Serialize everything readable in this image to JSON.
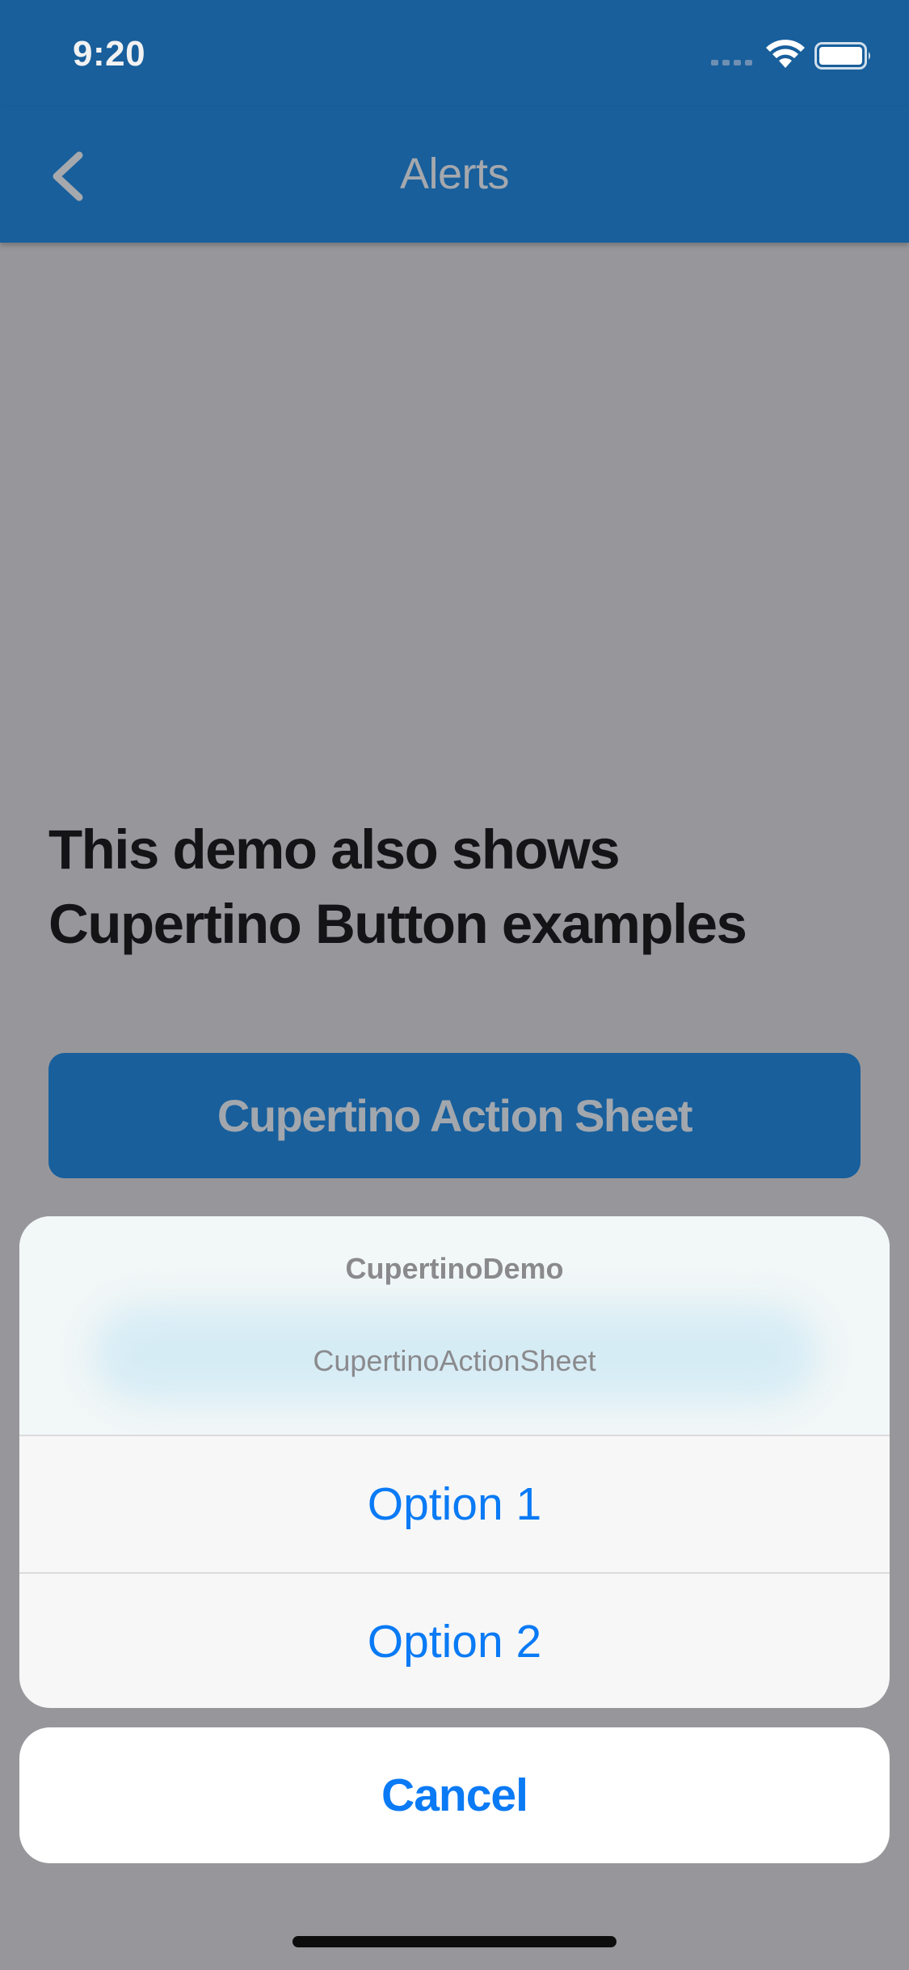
{
  "status_bar": {
    "time": "9:20",
    "icons": [
      "cellular-signal-icon",
      "wifi-icon",
      "battery-icon"
    ]
  },
  "nav_bar": {
    "title": "Alerts",
    "back_icon": "chevron-left-icon"
  },
  "content": {
    "heading": "This demo also shows Cupertino Button examples",
    "action_sheet_button_label": "Cupertino Action Sheet"
  },
  "action_sheet": {
    "title": "CupertinoDemo",
    "message": "CupertinoActionSheet",
    "options": [
      "Option 1",
      "Option 2"
    ],
    "cancel_label": "Cancel"
  },
  "colors": {
    "app_bar": "#185f9c",
    "scrim": "#97979b",
    "action_text": "#0a7af5"
  }
}
